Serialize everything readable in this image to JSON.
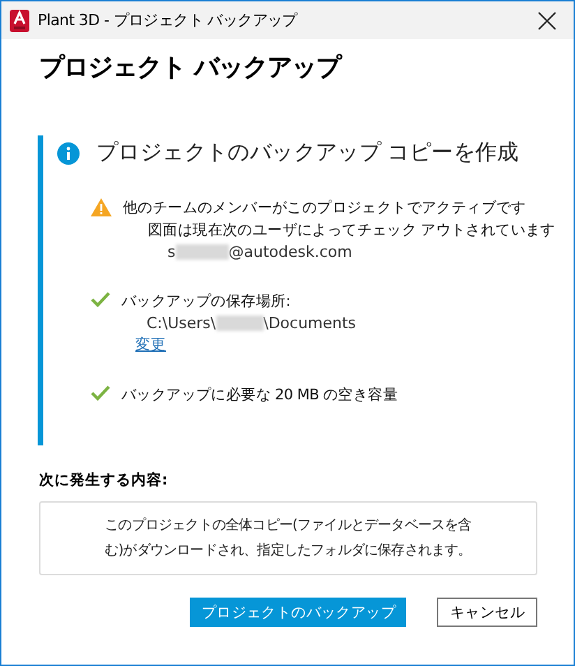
{
  "window": {
    "title": "Plant 3D - プロジェクト バックアップ"
  },
  "heading": "プロジェクト バックアップ",
  "panel": {
    "title": "プロジェクトのバックアップ コピーを作成",
    "items": [
      {
        "kind": "warning",
        "title": "他のチームのメンバーがこのプロジェクトでアクティブです",
        "detail": "図面は現在次のユーザによってチェック アウトされています",
        "value_start": "s",
        "value_end": "@autodesk.com"
      },
      {
        "kind": "success",
        "title": "バックアップの保存場所:",
        "value_start": "C:\\Users\\",
        "value_end": "\\Documents",
        "link": "変更"
      },
      {
        "kind": "success",
        "title": "バックアップに必要な 20 MB の空き容量"
      }
    ]
  },
  "next": {
    "label": "次に発生する内容:",
    "description": "このプロジェクトの全体コピー(ファイルとデータベースを含む)がダウンロードされ、指定したフォルダに保存されます。"
  },
  "buttons": [
    {
      "label": "プロジェクトのバックアップ",
      "kind": "primary"
    },
    {
      "label": "キャンセル",
      "kind": "secondary"
    }
  ]
}
